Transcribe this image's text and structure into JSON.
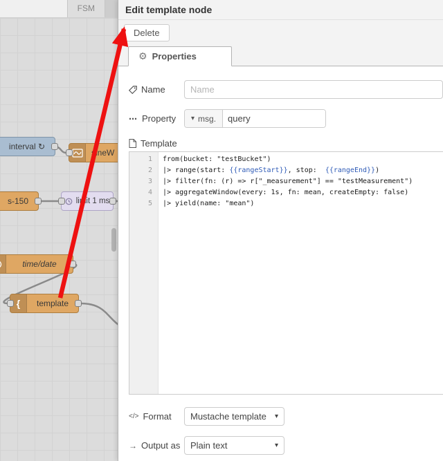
{
  "colors": {
    "annotation_arrow": "#ee1111",
    "mustache_token": "#2f5bb7",
    "node_orange": "#dfa763",
    "node_blue": "#a9bdd1",
    "node_lavender": "#e2dcef"
  },
  "workspace": {
    "tab_label": "FSM",
    "nodes": [
      {
        "label": "interval ↻"
      },
      {
        "label": "sineW"
      },
      {
        "label": "s-150"
      },
      {
        "label": "limit 1 ms"
      },
      {
        "label": "time/date"
      },
      {
        "label": "template"
      }
    ]
  },
  "dialog": {
    "title": "Edit template node",
    "toolbar": {
      "delete_label": "Delete"
    },
    "tabs": [
      {
        "label": "Properties",
        "icon": "⚙"
      }
    ],
    "fields": {
      "name": {
        "label": "Name",
        "placeholder": "Name"
      },
      "property": {
        "label": "Property",
        "icon": "⋯",
        "caret": "▾",
        "type_prefix": "msg.",
        "value": "query"
      },
      "template": {
        "label": "Template"
      },
      "format": {
        "label": "Format",
        "icon": "</>",
        "caret": "▾",
        "value": "Mustache template"
      },
      "output": {
        "label": "Output as",
        "icon": "→",
        "caret": "▾",
        "value": "Plain text"
      }
    },
    "editor": {
      "lines": [
        "from(bucket: \"testBucket\")",
        "|> range(start: {{rangeStart}}, stop:  {{rangeEnd}})",
        "|> filter(fn: (r) => r[\"_measurement\"] == \"testMeasurement\")",
        "|> aggregateWindow(every: 1s, fn: mean, createEmpty: false)",
        "|> yield(name: \"mean\")"
      ]
    }
  }
}
